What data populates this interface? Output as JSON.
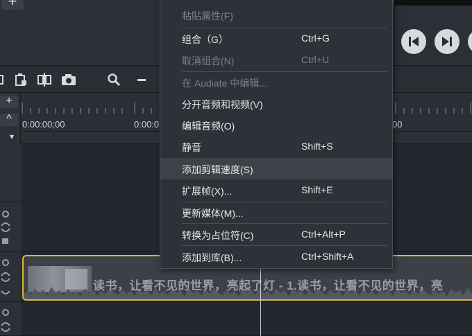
{
  "top": {
    "add_button": "+"
  },
  "ruler": {
    "time_labels": [
      "0:00:00;00",
      "0:00:0",
      "00"
    ]
  },
  "side": {
    "add": "+",
    "collapse": "^",
    "expand": "▾"
  },
  "clip": {
    "title": "读书，让看不见的世界，亮起了灯 - 1.读书，让看不见的世界，亮"
  },
  "context_menu": {
    "items": [
      {
        "label": "",
        "shortcut": "",
        "disabled": true
      },
      {
        "label": "粘贴属性(F)",
        "shortcut": "",
        "disabled": true
      },
      {
        "label": "组合（G）",
        "shortcut": "Ctrl+G",
        "disabled": false
      },
      {
        "label": "取消组合(N)",
        "shortcut": "Ctrl+U",
        "disabled": true
      },
      {
        "label": "在 Audiate 中编辑...",
        "shortcut": "",
        "disabled": true
      },
      {
        "label": "分开音频和视频(V)",
        "shortcut": "",
        "disabled": false
      },
      {
        "label": "编辑音频(O)",
        "shortcut": "",
        "disabled": false
      },
      {
        "label": "静音",
        "shortcut": "Shift+S",
        "disabled": false
      },
      {
        "label": "添加剪辑速度(S)",
        "shortcut": "",
        "disabled": false,
        "highlighted": true
      },
      {
        "label": "扩展帧(X)...",
        "shortcut": "Shift+E",
        "disabled": false
      },
      {
        "label": "更新媒体(M)...",
        "shortcut": "",
        "disabled": false
      },
      {
        "label": "转换为占位符(C)",
        "shortcut": "Ctrl+Alt+P",
        "disabled": false
      },
      {
        "label": "添加到库(B)...",
        "shortcut": "Ctrl+Shift+A",
        "disabled": false
      }
    ]
  },
  "colors": {
    "clip_border": "#e0b640",
    "menu_bg": "#2d3138",
    "menu_highlight": "#3d4249"
  }
}
